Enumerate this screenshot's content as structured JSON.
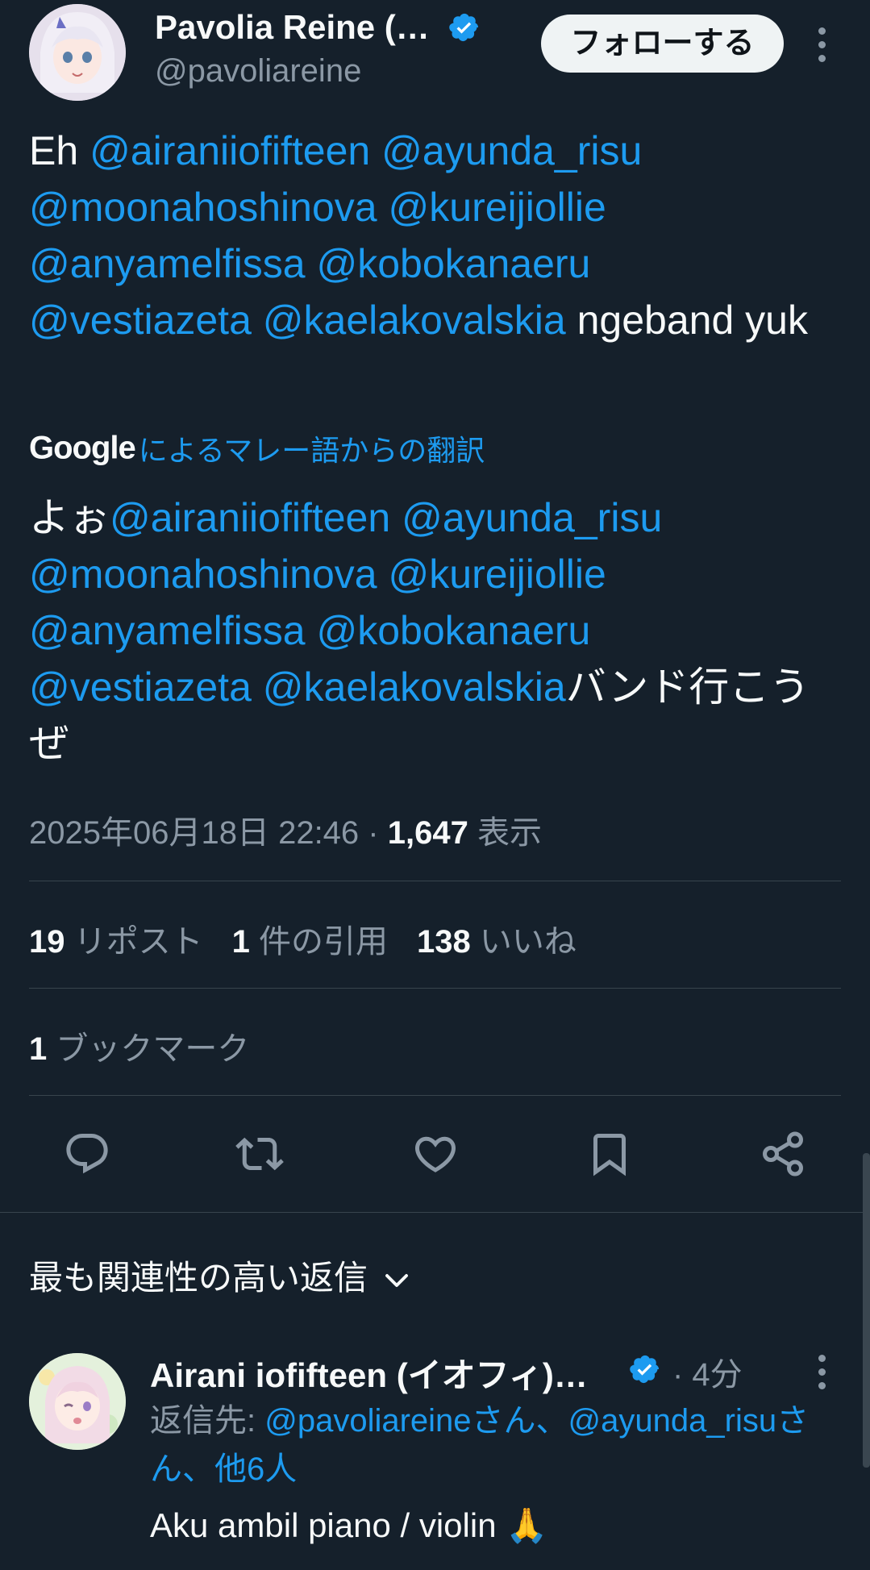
{
  "tweet": {
    "author_name": "Pavolia Reine (…",
    "author_handle": "@pavoliareine",
    "follow_label": "フォローする",
    "text": {
      "prefix": "Eh ",
      "mentions": [
        "@airaniiofifteen",
        "@ayunda_risu",
        "@moonahoshinova",
        "@kureijiollie",
        "@anyamelfissa",
        "@kobokanaeru",
        "@vestiazeta",
        "@kaelakovalskia"
      ],
      "suffix": " ngeband yuk"
    },
    "translation": {
      "provider": "Google",
      "label": "によるマレー語からの翻訳",
      "prefix": "よぉ",
      "suffix": "バンド行こうぜ"
    },
    "timestamp": "2025年06月18日 22:46",
    "separator": " · ",
    "views_count": "1,647",
    "views_label": "表示",
    "stats": {
      "reposts_count": "19",
      "reposts_label": "リポスト",
      "quotes_count": "1",
      "quotes_label": "件の引用",
      "likes_count": "138",
      "likes_label": "いいね",
      "bookmarks_count": "1",
      "bookmarks_label": "ブックマーク"
    }
  },
  "actions": [
    "reply-icon",
    "repost-icon",
    "like-icon",
    "bookmark-icon",
    "share-icon"
  ],
  "replies": {
    "sort_label": "最も関連性の高い返信",
    "items": [
      {
        "author_name": "Airani iofifteen (イオフィ)…",
        "time": "· 4分",
        "reply_to_label": "返信先: ",
        "reply_to_link_1": "@pavoliareineさん、@ayunda_risuさん、",
        "reply_to_link_2": "他6人",
        "text": "Aku ambil piano / violin 🙏"
      }
    ]
  },
  "colors": {
    "background": "#15202b",
    "text": "#f7f9f9",
    "muted": "#8b98a5",
    "link": "#1d9bf0",
    "divider": "#38444d"
  }
}
